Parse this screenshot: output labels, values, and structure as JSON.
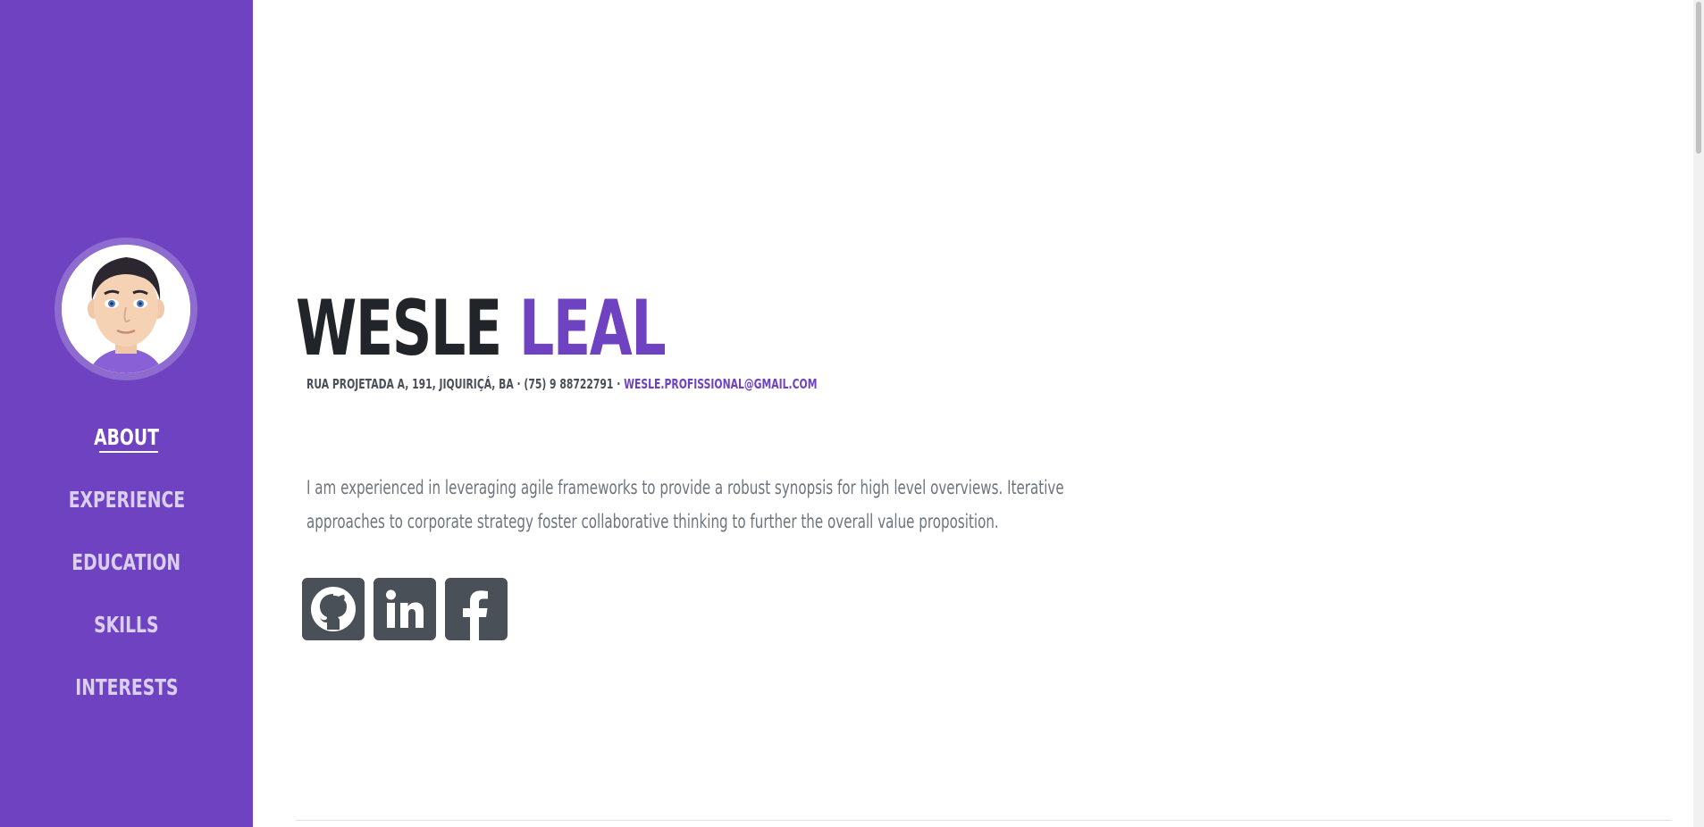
{
  "sidebar": {
    "avatar_alt": "avatar",
    "nav": [
      {
        "label": "About",
        "active": true
      },
      {
        "label": "Experience",
        "active": false
      },
      {
        "label": "Education",
        "active": false
      },
      {
        "label": "Skills",
        "active": false
      },
      {
        "label": "Interests",
        "active": false
      }
    ],
    "color": "#6f42c1"
  },
  "about": {
    "first_name": "WESLE",
    "last_name": "LEAL",
    "address": "RUA PROJETADA A, 191, JIQUIRIÇÁ, BA · (75) 9 88722791 ·",
    "email": "WESLE.PROFISSIONAL@GMAIL.COM",
    "lead": "I am experienced in leveraging agile frameworks to provide a robust synopsis for high level overviews. Iterative approaches to corporate strategy foster collaborative thinking to further the overall value proposition.",
    "social": [
      {
        "name": "github-icon"
      },
      {
        "name": "linkedin-icon"
      },
      {
        "name": "facebook-icon"
      }
    ]
  },
  "colors": {
    "accent": "#6f42c1",
    "dark": "#212529",
    "muted": "#6c757d",
    "social_bg": "#495057"
  }
}
